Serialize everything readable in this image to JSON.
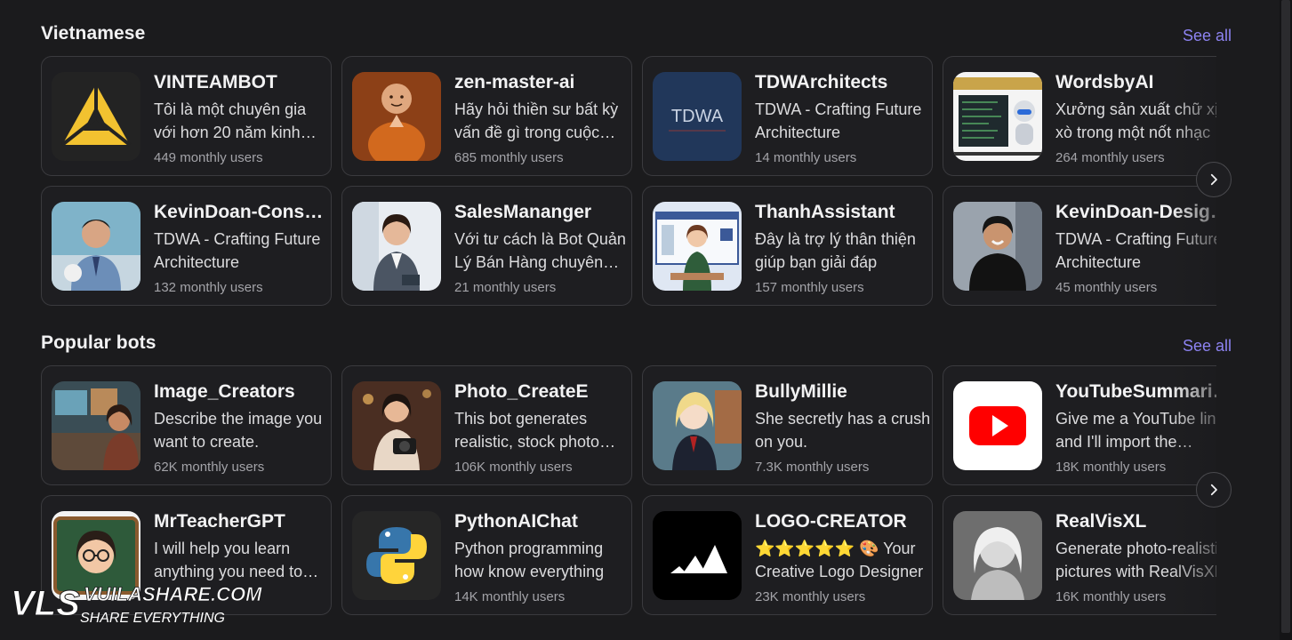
{
  "sections": [
    {
      "title": "Vietnamese",
      "see_all": "See all",
      "cards": [
        {
          "name": "VINTEAMBOT",
          "desc": "Tôi là một chuyên gia với hơn 20 năm kinh nghiệm",
          "users": "449 monthly users",
          "icon": "triangle-logo-icon"
        },
        {
          "name": "zen-master-ai",
          "desc": "Hãy hỏi thiền sư bất kỳ vấn đề gì trong cuộc sống",
          "users": "685 monthly users",
          "icon": "monk-avatar"
        },
        {
          "name": "TDWArchitects",
          "desc": "TDWA - Crafting Future Architecture",
          "users": "14 monthly users",
          "icon": "tdwa-logo"
        },
        {
          "name": "WordsbyAI",
          "desc": "Xưởng sản xuất chữ xịn xò trong một nốt nhạc",
          "users": "264 monthly users",
          "icon": "robot-avatar"
        },
        {
          "name": "KevinDoan-Consultant",
          "desc": "TDWA - Crafting Future Architecture",
          "users": "132 monthly users",
          "icon": "consultant-avatar"
        },
        {
          "name": "SalesMananger",
          "desc": "Với tư cách là Bot Quản Lý Bán Hàng chuyên nghiệp",
          "users": "21 monthly users",
          "icon": "saleswoman-avatar"
        },
        {
          "name": "ThanhAssistant",
          "desc": "Đây là trợ lý thân thiện giúp bạn giải đáp",
          "users": "157 monthly users",
          "icon": "assistant-avatar"
        },
        {
          "name": "KevinDoan-Designer",
          "desc": "TDWA - Crafting Future Architecture",
          "users": "45 monthly users",
          "icon": "designer-avatar"
        }
      ]
    },
    {
      "title": "Popular bots",
      "see_all": "See all",
      "cards": [
        {
          "name": "Image_Creators",
          "desc": "Describe the image you want to create.",
          "users": "62K monthly users",
          "icon": "artist-avatar"
        },
        {
          "name": "Photo_CreateE",
          "desc": "This bot generates realistic, stock photo style images",
          "users": "106K monthly users",
          "icon": "photographer-avatar"
        },
        {
          "name": "BullyMillie",
          "desc": "She secretly has a crush on you.",
          "users": "7.3K monthly users",
          "icon": "anime-girl-avatar"
        },
        {
          "name": "YouTubeSummarizer",
          "desc": "Give me a YouTube link, and I'll import the transcript",
          "users": "18K monthly users",
          "icon": "youtube-icon"
        },
        {
          "name": "MrTeacherGPT",
          "desc": "I will help you learn anything you need to know",
          "users": "",
          "icon": "teacher-avatar"
        },
        {
          "name": "PythonAIChat",
          "desc": "Python programming how know everything",
          "users": "14K monthly users",
          "icon": "python-icon"
        },
        {
          "name": "LOGO-CREATOR",
          "desc": "⭐⭐⭐⭐⭐ 🎨 Your Creative Logo Designer",
          "users": "23K monthly users",
          "icon": "adidas-logo"
        },
        {
          "name": "RealVisXL",
          "desc": "Generate photo-realistic pictures with RealVisXL",
          "users": "16K monthly users",
          "icon": "portrait-avatar"
        }
      ]
    }
  ],
  "watermark": {
    "brand": "VUILASHARE.COM",
    "tagline": "SHARE EVERYTHING",
    "mark": "VLS"
  },
  "colors": {
    "background": "#1b1b1d",
    "card_border": "#3a3a3e",
    "accent": "#8c82f0"
  }
}
